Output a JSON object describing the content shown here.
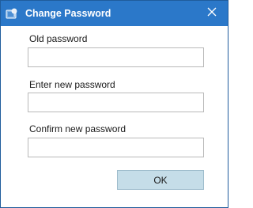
{
  "window": {
    "title": "Change Password",
    "icon": "key-app-icon",
    "close_icon": "close-icon",
    "titlebar_color": "#2b78c9"
  },
  "form": {
    "old_password": {
      "label": "Old password",
      "value": "",
      "placeholder": ""
    },
    "new_password": {
      "label": "Enter new password",
      "value": "",
      "placeholder": ""
    },
    "confirm_password": {
      "label": "Confirm new password",
      "value": "",
      "placeholder": ""
    }
  },
  "buttons": {
    "ok_label": "OK",
    "ok_color": "#c5dde8"
  }
}
